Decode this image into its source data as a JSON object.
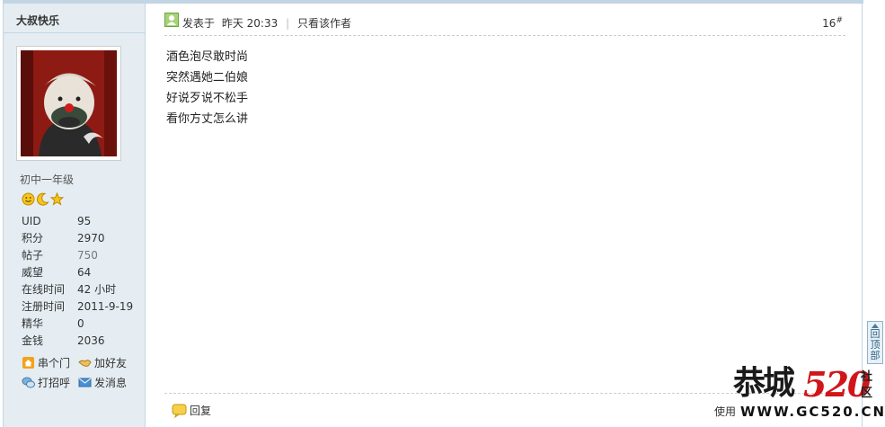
{
  "author": {
    "name": "大叔快乐",
    "group": "初中一年级",
    "rank_icons": [
      "smile-icon",
      "moon-icon",
      "star-icon"
    ],
    "stats": [
      {
        "label": "UID",
        "value": "95"
      },
      {
        "label": "积分",
        "value": "2970"
      },
      {
        "label": "帖子",
        "value": "750"
      },
      {
        "label": "威望",
        "value": "64"
      },
      {
        "label": "在线时间",
        "value": "42 小时"
      },
      {
        "label": "注册时间",
        "value": "2011-9-19"
      },
      {
        "label": "精华",
        "value": "0"
      },
      {
        "label": "金钱",
        "value": "2036"
      }
    ],
    "links": {
      "visit": "串个门",
      "add_friend": "加好友",
      "greet": "打招呼",
      "message": "发消息"
    }
  },
  "post": {
    "posted_label": "发表于",
    "posted_time": "昨天 20:33",
    "pipe": "|",
    "only_author": "只看该作者",
    "floor": "16",
    "floor_sup": "#",
    "lines": [
      "酒色泡尽敢时尚",
      "突然遇她二伯娘",
      "好说歹说不松手",
      "看你方丈怎么讲"
    ],
    "reply_label": "回复",
    "using_label": "使用"
  },
  "back_to_top": "回顶部",
  "watermark": {
    "name": "恭城",
    "number": "520",
    "suffix": "社区",
    "url": "WWW.GC520.CN"
  },
  "colors": {
    "sidebar_bg": "#e5edf2",
    "border": "#c2d5e3",
    "watermark_red": "#d0161a"
  }
}
